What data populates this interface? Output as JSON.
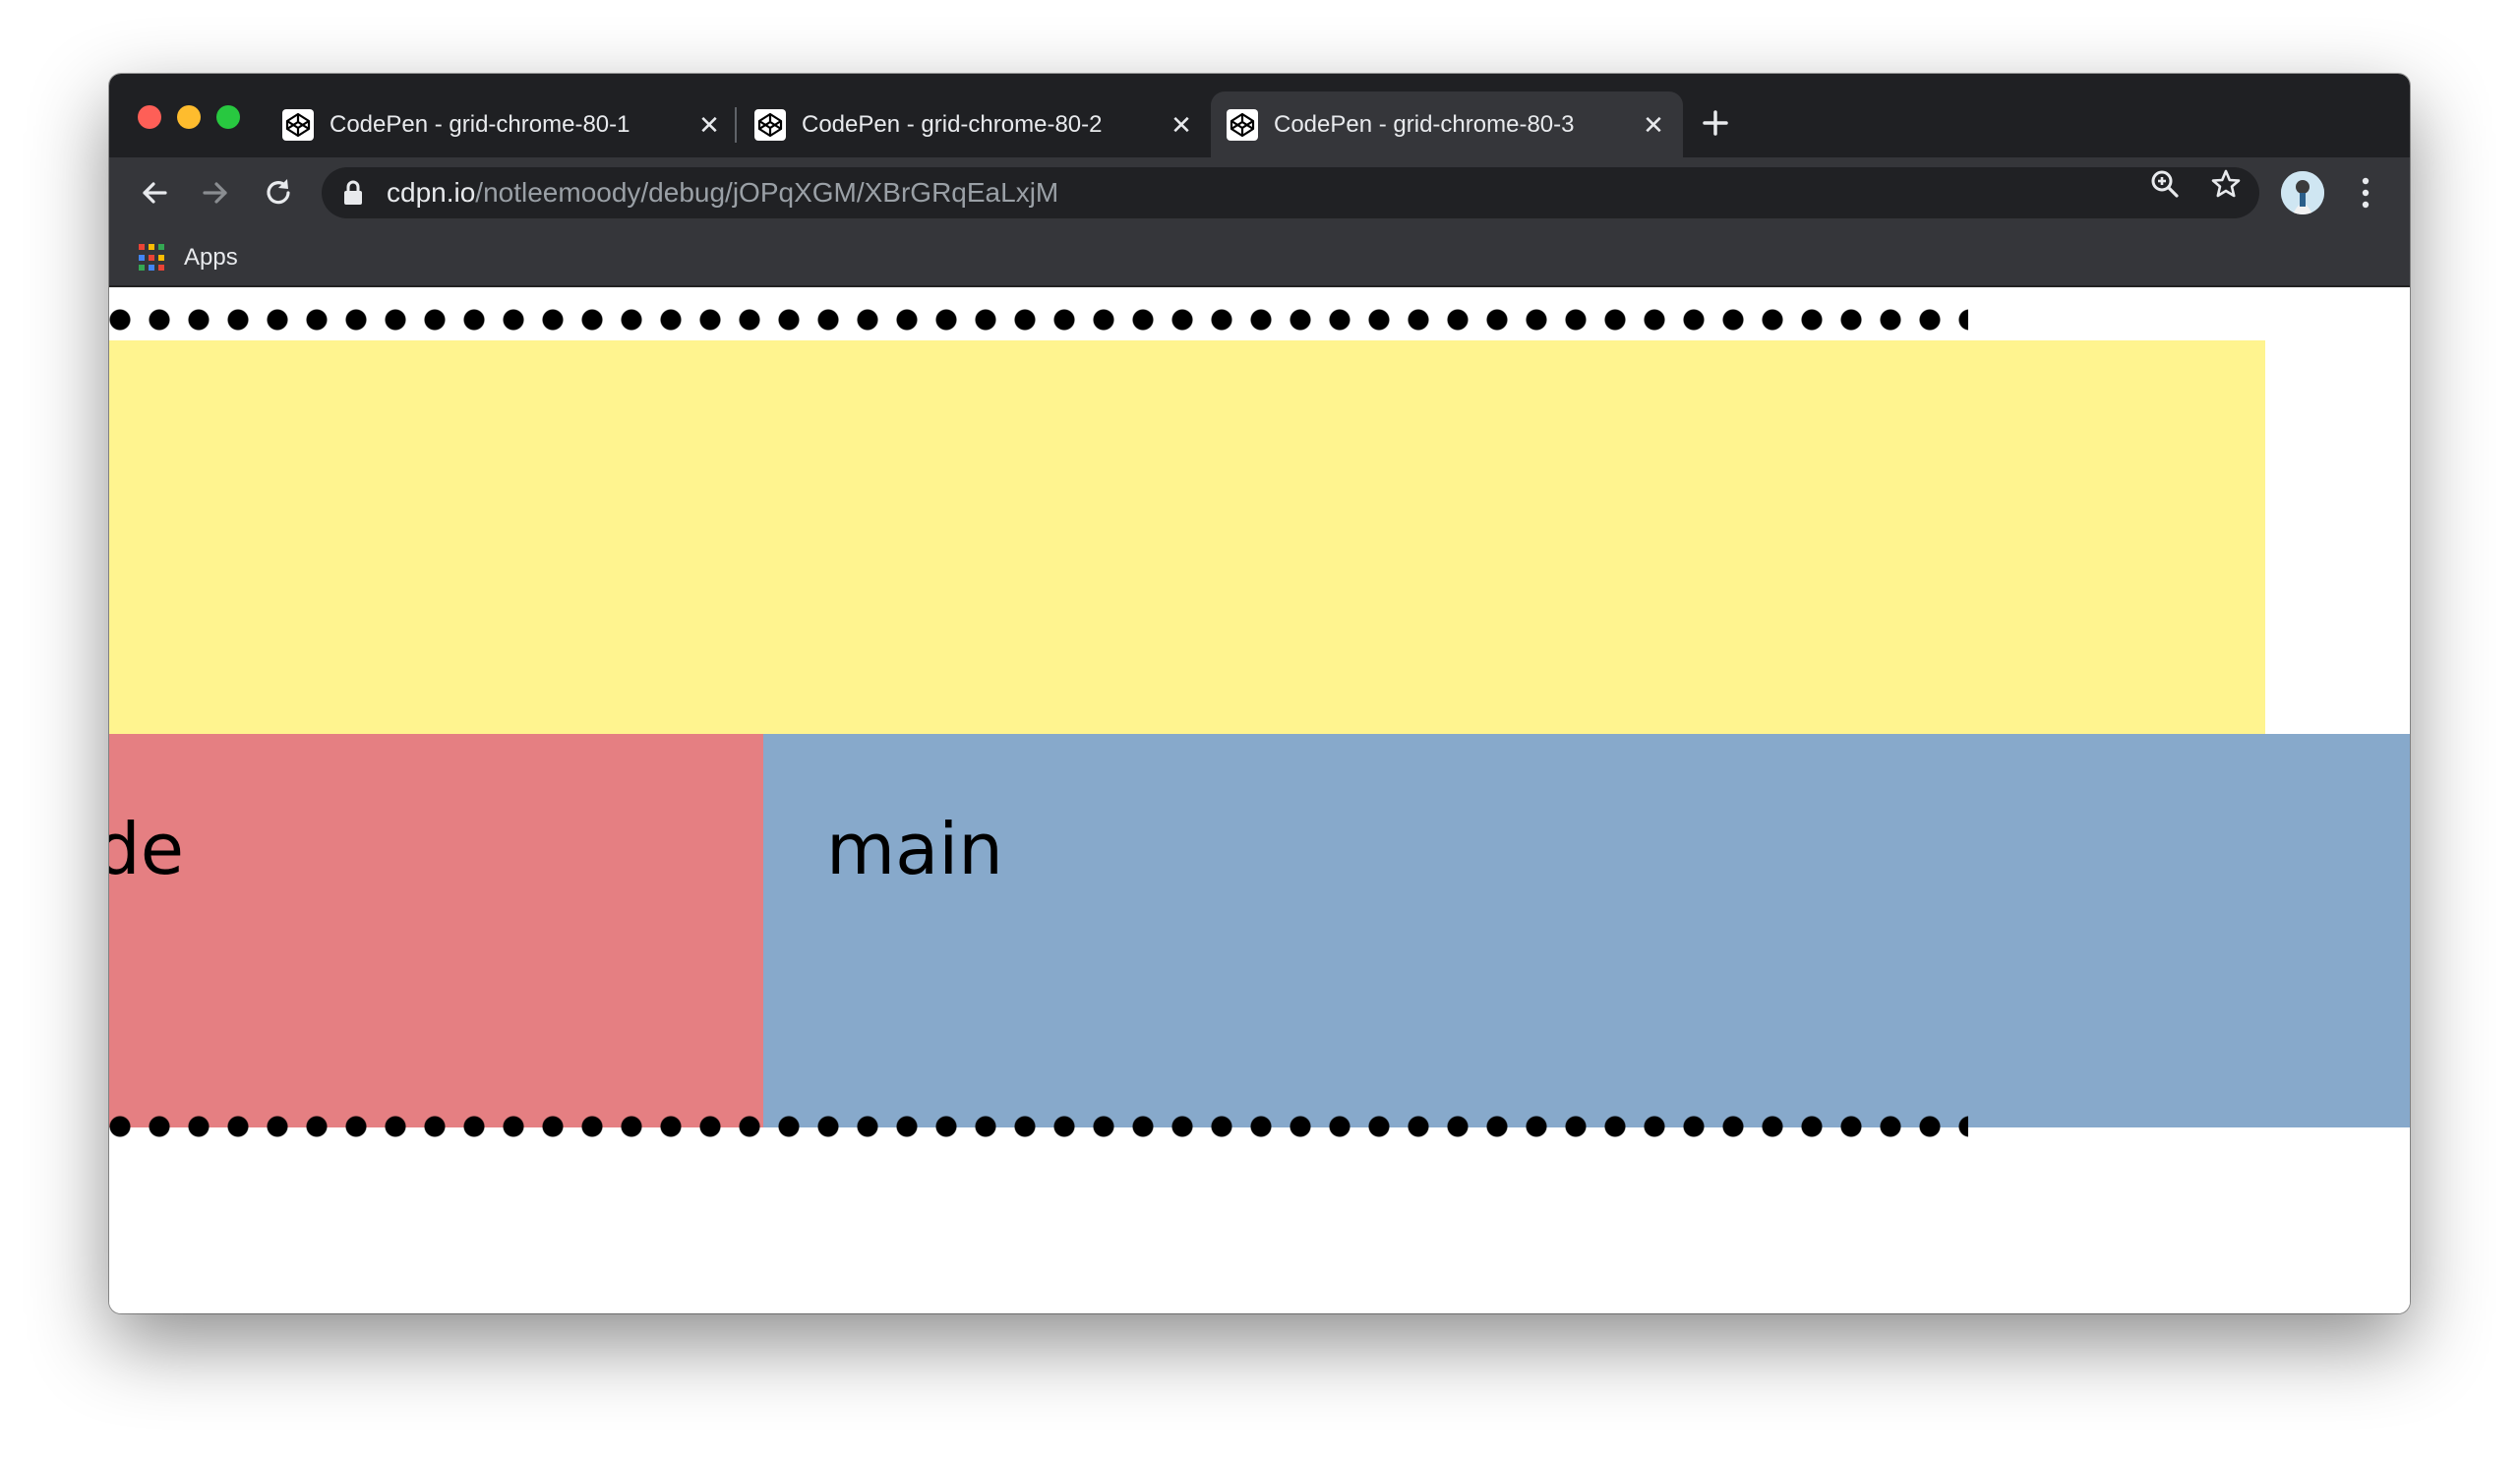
{
  "tabs": [
    {
      "title": "CodePen - grid-chrome-80-1",
      "favicon": "codepen-icon",
      "active": false
    },
    {
      "title": "CodePen - grid-chrome-80-2",
      "favicon": "codepen-icon",
      "active": false
    },
    {
      "title": "CodePen - grid-chrome-80-3",
      "favicon": "codepen-icon",
      "active": true
    }
  ],
  "address_bar": {
    "host": "cdpn.io",
    "path": "/notleemoody/debug/jOPqXGM/XBrGRqEaLxjM"
  },
  "bookmarks": {
    "apps_label": "Apps"
  },
  "page": {
    "aside_label": "aside",
    "main_label": "main",
    "colors": {
      "header": "#fff48f",
      "aside": "#e57f82",
      "main": "#87a9cb",
      "dots": "#000000"
    }
  }
}
